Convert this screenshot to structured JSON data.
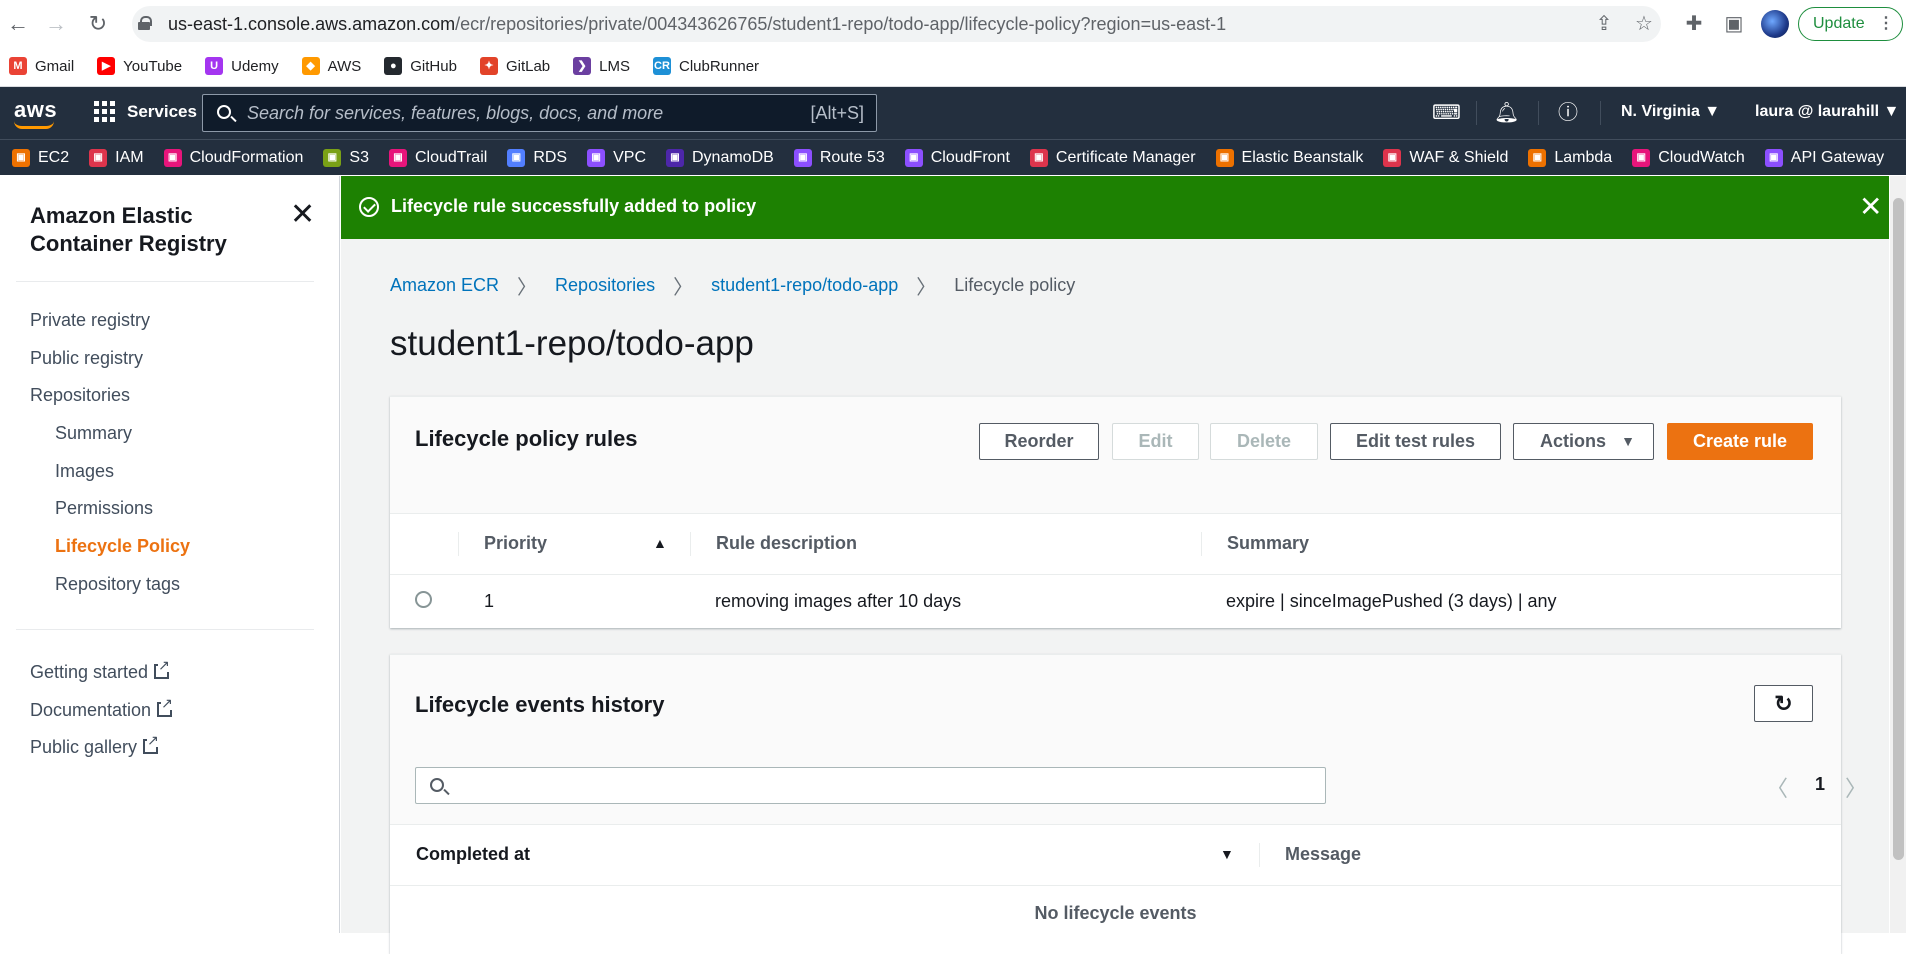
{
  "browser": {
    "url_host": "us-east-1.console.aws.amazon.com",
    "url_path": "/ecr/repositories/private/004343626765/student1-repo/todo-app/lifecycle-policy?region=us-east-1",
    "update_label": "Update",
    "bookmarks": [
      {
        "label": "Gmail",
        "icon": "gmail-icon",
        "color": "#ea4335",
        "glyph": "M"
      },
      {
        "label": "YouTube",
        "icon": "youtube-icon",
        "color": "#ff0000",
        "glyph": "▶"
      },
      {
        "label": "Udemy",
        "icon": "udemy-icon",
        "color": "#a435f0",
        "glyph": "U"
      },
      {
        "label": "AWS",
        "icon": "aws-icon",
        "color": "#ff9900",
        "glyph": "◆"
      },
      {
        "label": "GitHub",
        "icon": "github-icon",
        "color": "#24292f",
        "glyph": "●"
      },
      {
        "label": "GitLab",
        "icon": "gitlab-icon",
        "color": "#e24329",
        "glyph": "✦"
      },
      {
        "label": "LMS",
        "icon": "lms-icon",
        "color": "#6b3fa0",
        "glyph": "❯"
      },
      {
        "label": "ClubRunner",
        "icon": "clubrunner-icon",
        "color": "#1e90d6",
        "glyph": "CR"
      }
    ]
  },
  "aws_header": {
    "services_label": "Services",
    "search_placeholder": "Search for services, features, blogs, docs, and more",
    "search_hint": "[Alt+S]",
    "region": "N. Virginia",
    "account": "laura @ laurahill",
    "favorites": [
      {
        "label": "EC2",
        "icon": "ec2-icon",
        "color": "#ed7100"
      },
      {
        "label": "IAM",
        "icon": "iam-icon",
        "color": "#dd344c"
      },
      {
        "label": "CloudFormation",
        "icon": "cloudformation-icon",
        "color": "#e7157b"
      },
      {
        "label": "S3",
        "icon": "s3-icon",
        "color": "#7aa116"
      },
      {
        "label": "CloudTrail",
        "icon": "cloudtrail-icon",
        "color": "#e7157b"
      },
      {
        "label": "RDS",
        "icon": "rds-icon",
        "color": "#527fff"
      },
      {
        "label": "VPC",
        "icon": "vpc-icon",
        "color": "#8c4fff"
      },
      {
        "label": "DynamoDB",
        "icon": "dynamodb-icon",
        "color": "#4d27aa"
      },
      {
        "label": "Route 53",
        "icon": "route53-icon",
        "color": "#8c4fff"
      },
      {
        "label": "CloudFront",
        "icon": "cloudfront-icon",
        "color": "#8c4fff"
      },
      {
        "label": "Certificate Manager",
        "icon": "certificate-manager-icon",
        "color": "#dd344c"
      },
      {
        "label": "Elastic Beanstalk",
        "icon": "elastic-beanstalk-icon",
        "color": "#ed7100"
      },
      {
        "label": "WAF & Shield",
        "icon": "waf-shield-icon",
        "color": "#dd344c"
      },
      {
        "label": "Lambda",
        "icon": "lambda-icon",
        "color": "#ed7100"
      },
      {
        "label": "CloudWatch",
        "icon": "cloudwatch-icon",
        "color": "#e7157b"
      },
      {
        "label": "API Gateway",
        "icon": "api-gateway-icon",
        "color": "#8c4fff"
      }
    ]
  },
  "sidebar": {
    "title": "Amazon Elastic Container Registry",
    "items": [
      {
        "label": "Private registry",
        "level": 0
      },
      {
        "label": "Public registry",
        "level": 0
      },
      {
        "label": "Repositories",
        "level": 0
      },
      {
        "label": "Summary",
        "level": 1
      },
      {
        "label": "Images",
        "level": 1
      },
      {
        "label": "Permissions",
        "level": 1
      },
      {
        "label": "Lifecycle Policy",
        "level": 1,
        "active": true
      },
      {
        "label": "Repository tags",
        "level": 1
      }
    ],
    "links": [
      "Getting started",
      "Documentation",
      "Public gallery"
    ]
  },
  "flash": {
    "message": "Lifecycle rule successfully added to policy",
    "color": "#1d8102"
  },
  "breadcrumbs": [
    "Amazon ECR",
    "Repositories",
    "student1-repo/todo-app",
    "Lifecycle policy"
  ],
  "page_title": "student1-repo/todo-app",
  "rules_panel": {
    "title": "Lifecycle policy rules",
    "buttons": {
      "reorder": "Reorder",
      "edit": "Edit",
      "delete": "Delete",
      "edit_test_rules": "Edit test rules",
      "actions": "Actions",
      "create_rule": "Create rule"
    },
    "columns": [
      "Priority",
      "Rule description",
      "Summary"
    ],
    "rows": [
      {
        "priority": "1",
        "description": "removing images after 10 days",
        "summary": "expire | sinceImagePushed (3 days) | any"
      }
    ]
  },
  "events_panel": {
    "title": "Lifecycle events history",
    "page": "1",
    "columns": [
      "Completed at",
      "Message"
    ],
    "empty_message": "No lifecycle events"
  },
  "accent_color": "#ec7211",
  "link_color": "#0073bb"
}
